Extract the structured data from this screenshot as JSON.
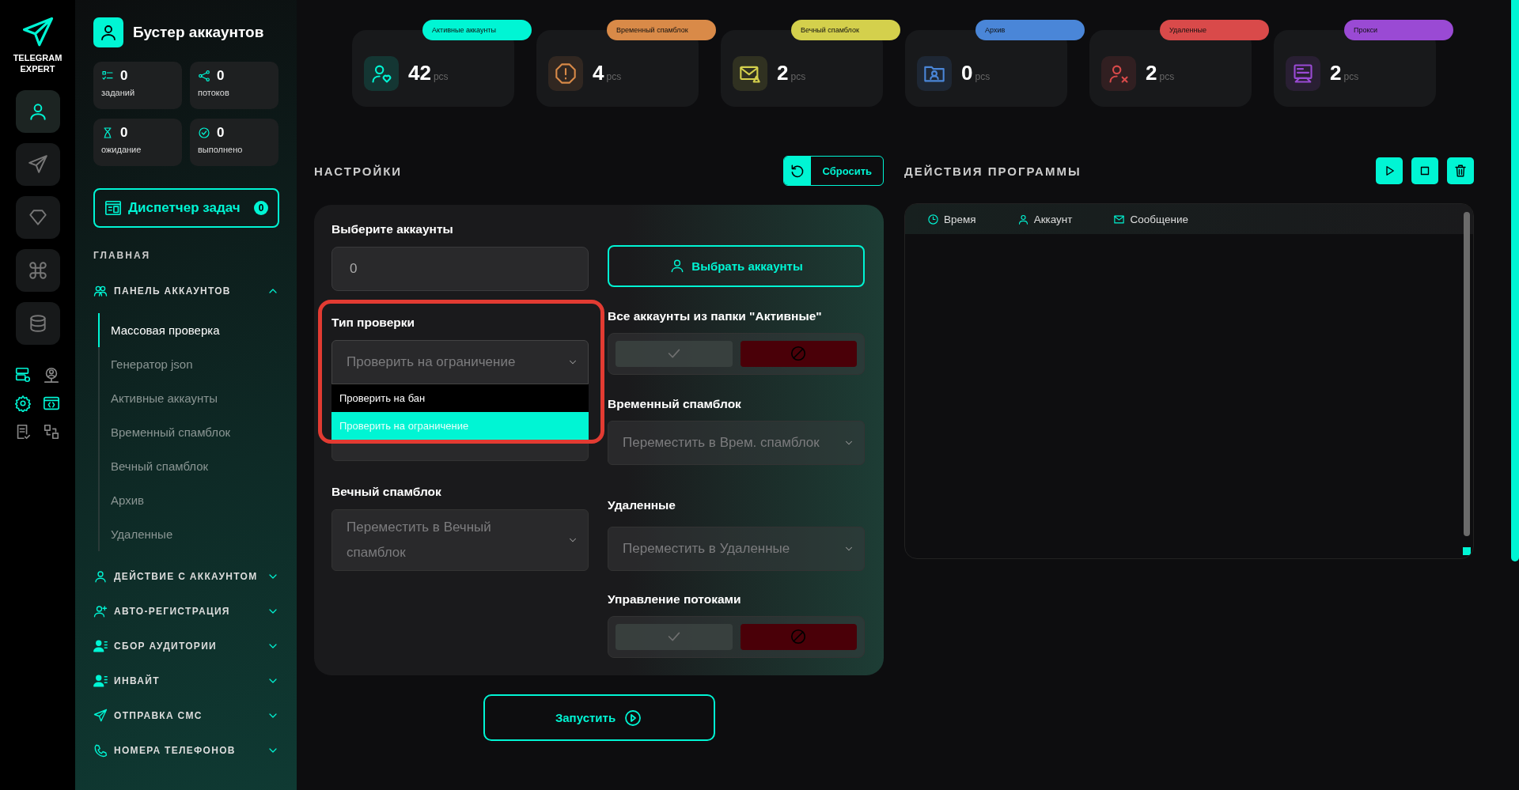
{
  "logo": {
    "lines": [
      "TELEGRAM",
      "EXPERT"
    ]
  },
  "rail": {
    "items": [
      {
        "selected": true
      },
      {
        "selected": false
      },
      {
        "selected": false
      },
      {
        "selected": false
      },
      {
        "selected": false
      }
    ]
  },
  "header": {
    "title": "Бустер аккаунтов"
  },
  "counters": [
    {
      "value": "0",
      "label": "заданий"
    },
    {
      "value": "0",
      "label": "потоков"
    },
    {
      "value": "0",
      "label": "ожидание"
    },
    {
      "value": "0",
      "label": "выполнено"
    }
  ],
  "task_manager": {
    "label": "Диспетчер задач",
    "count": "0"
  },
  "nav": {
    "heading": "ГЛАВНАЯ",
    "groups": [
      {
        "label": "ПАНЕЛЬ АККАУНТОВ",
        "expanded": true,
        "children": [
          {
            "label": "Массовая проверка",
            "selected": true
          },
          {
            "label": "Генератор json",
            "selected": false
          },
          {
            "label": "Активные аккаунты",
            "selected": false
          },
          {
            "label": "Временный спамблок",
            "selected": false
          },
          {
            "label": "Вечный спамблок",
            "selected": false
          },
          {
            "label": "Архив",
            "selected": false
          },
          {
            "label": "Удаленные",
            "selected": false
          }
        ]
      },
      {
        "label": "ДЕЙСТВИЕ С АККАУНТОМ",
        "expanded": false
      },
      {
        "label": "АВТО-РЕГИСТРАЦИЯ",
        "expanded": false
      },
      {
        "label": "СБОР АУДИТОРИИ",
        "expanded": false
      },
      {
        "label": "ИНВАЙТ",
        "expanded": false
      },
      {
        "label": "ОТПРАВКА СМС",
        "expanded": false
      },
      {
        "label": "НОМЕРА ТЕЛЕФОНОВ",
        "expanded": false
      }
    ]
  },
  "stats": [
    {
      "label": "Активные аккаунты",
      "value": "42",
      "unit": "pcs",
      "color": "#00f5d4"
    },
    {
      "label": "Временный спамблок",
      "value": "4",
      "unit": "pcs",
      "color": "#d98a48"
    },
    {
      "label": "Вечный спамблок",
      "value": "2",
      "unit": "pcs",
      "color": "#d4d04c"
    },
    {
      "label": "Архив",
      "value": "0",
      "unit": "pcs",
      "color": "#4a86d8"
    },
    {
      "label": "Удаленные",
      "value": "2",
      "unit": "pcs",
      "color": "#d94a4a"
    },
    {
      "label": "Прокси",
      "value": "2",
      "unit": "pcs",
      "color": "#9a4ad4"
    }
  ],
  "settings": {
    "title": "НАСТРОЙКИ",
    "reset": "Сбросить",
    "accounts": {
      "label": "Выберите аккаунты",
      "value": "0",
      "button": "Выбрать аккаунты"
    },
    "check_type": {
      "label": "Тип проверки",
      "value": "Проверить на ограничение",
      "expanded": true,
      "options": [
        {
          "label": "Проверить на бан",
          "selected": false
        },
        {
          "label": "Проверить на ограничение",
          "selected": true
        }
      ]
    },
    "all_active": {
      "label": "Все аккаунты из папки \"Активные\"",
      "on": false
    },
    "temp_spamblock": {
      "label": "Временный спамблок",
      "placeholder": "Переместить в Врем. спамблок"
    },
    "perm_spamblock": {
      "label": "Вечный спамблок",
      "placeholder": "Переместить в Вечный спамблок"
    },
    "deleted": {
      "label": "Удаленные",
      "placeholder": "Переместить в Удаленные"
    },
    "threads": {
      "label": "Управление потоками",
      "on": false
    },
    "launch": "Запустить"
  },
  "log": {
    "title": "ДЕЙСТВИЯ ПРОГРАММЫ",
    "columns": [
      "Время",
      "Аккаунт",
      "Сообщение"
    ]
  }
}
